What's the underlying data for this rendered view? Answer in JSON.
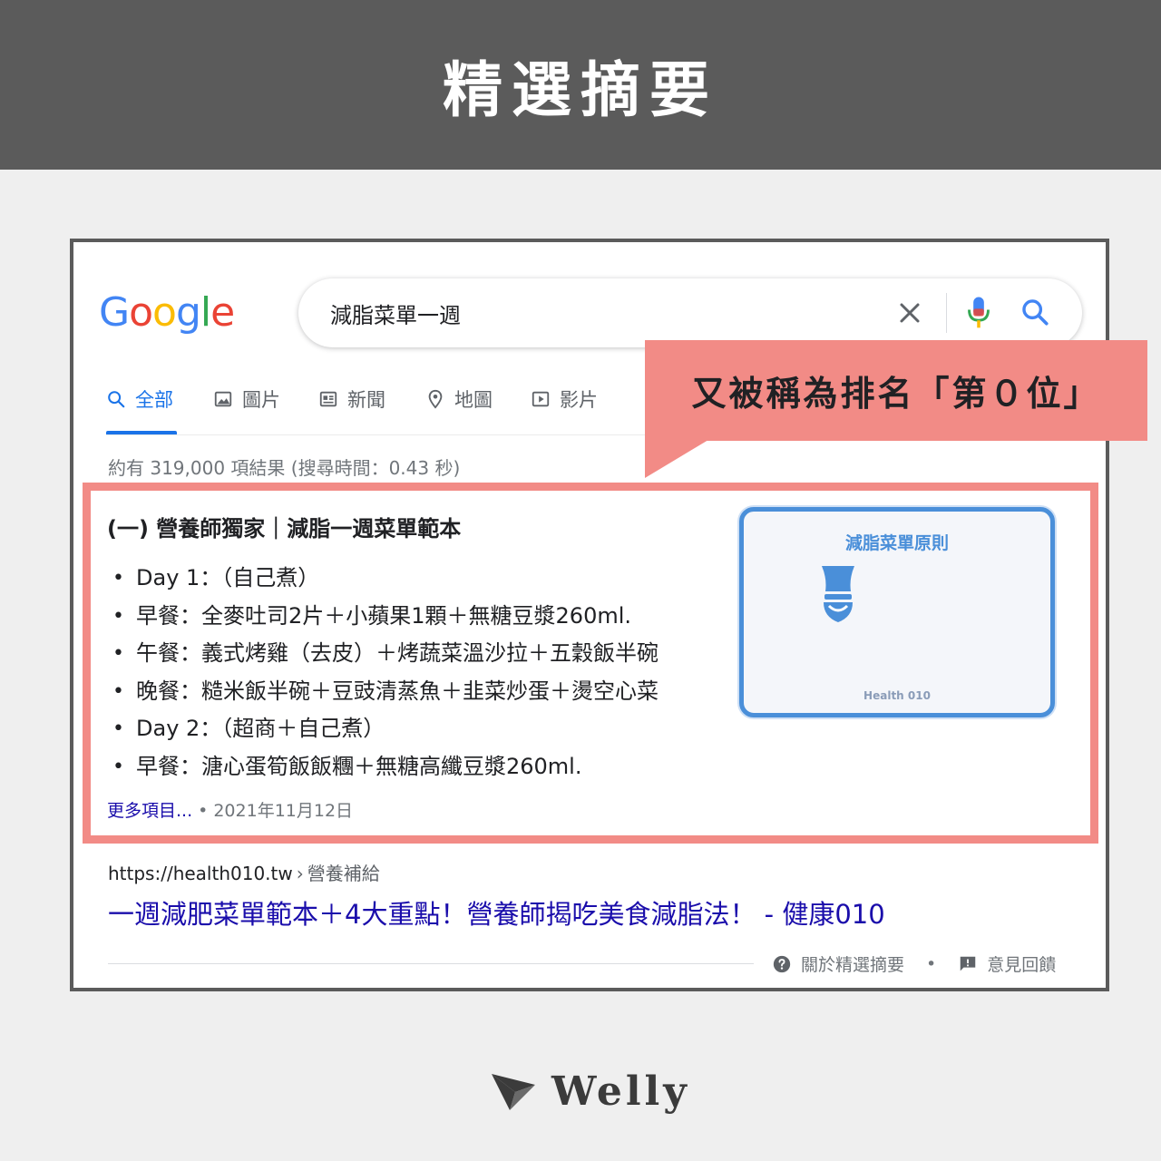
{
  "banner": {
    "title": "精選摘要"
  },
  "google": {
    "logo_letters": [
      {
        "char": "G",
        "color": "#4285F4"
      },
      {
        "char": "o",
        "color": "#EA4335"
      },
      {
        "char": "o",
        "color": "#FBBC05"
      },
      {
        "char": "g",
        "color": "#4285F4"
      },
      {
        "char": "l",
        "color": "#34A853"
      },
      {
        "char": "e",
        "color": "#EA4335"
      }
    ],
    "search": {
      "query": "減脂菜單一週"
    },
    "tabs": [
      {
        "label": "全部",
        "icon": "search-icon",
        "active": true
      },
      {
        "label": "圖片",
        "icon": "image-icon"
      },
      {
        "label": "新聞",
        "icon": "news-icon"
      },
      {
        "label": "地圖",
        "icon": "map-pin-icon"
      },
      {
        "label": "影片",
        "icon": "video-icon"
      }
    ],
    "stats": "約有 319,000 項結果 (搜尋時間：0.43 秒)"
  },
  "callout": {
    "text": "又被稱為排名「第０位」"
  },
  "snippet": {
    "title": "(一) 營養師獨家｜減脂一週菜單範本",
    "items": [
      "Day 1：（自己煮）",
      "早餐：全麥吐司2片＋小蘋果1顆＋無糖豆漿260ml.",
      "午餐：義式烤雞（去皮）＋烤蔬菜溫沙拉＋五穀飯半碗",
      "晚餐：糙米飯半碗＋豆豉清蒸魚＋韭菜炒蛋＋燙空心菜",
      "Day 2：（超商＋自己煮）",
      "早餐：溏心蛋筍飯飯糰＋無糖高纖豆漿260ml."
    ],
    "more_label": "更多項目...",
    "date": "2021年11月12日",
    "thumbnail": {
      "title": "減脂菜單原則",
      "brand": "Health 010"
    }
  },
  "result": {
    "url": "https://health010.tw",
    "crumb": "營養補給",
    "title": "一週減肥菜單範本＋4大重點！營養師揭吃美食減脂法！ - 健康010"
  },
  "footer": {
    "about": "關於精選摘要",
    "feedback": "意見回饋"
  },
  "brand": {
    "name": "Welly"
  },
  "colors": {
    "accent_blue": "#1a73e8",
    "callout": "#f28b86",
    "link": "#1a0dab"
  }
}
